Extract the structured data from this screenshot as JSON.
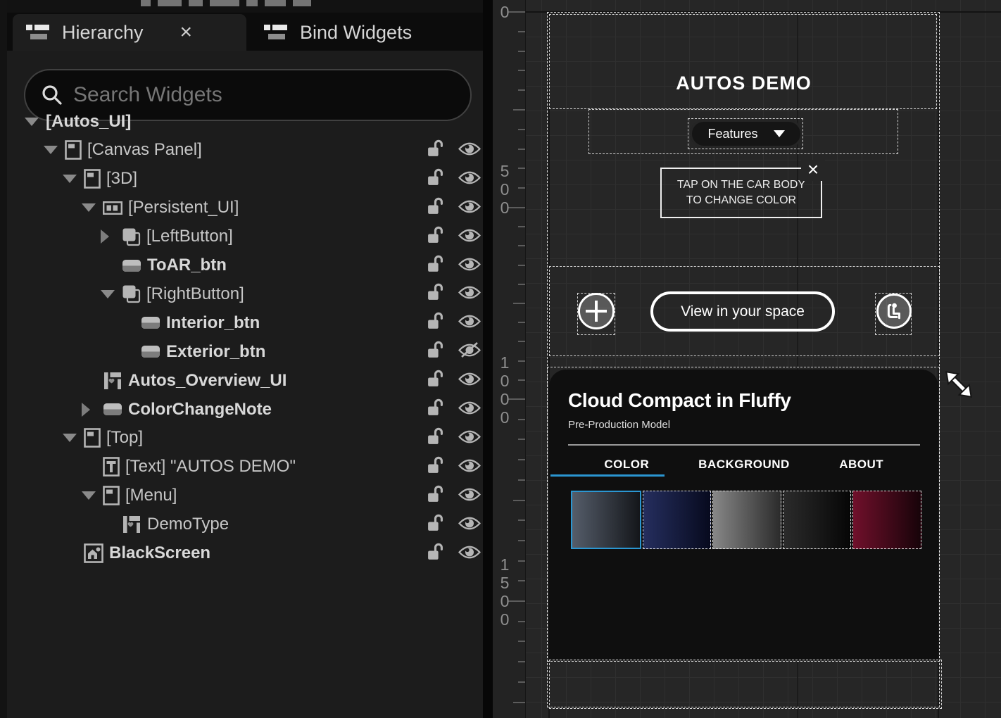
{
  "left_panel": {
    "tabs": [
      {
        "label": "Hierarchy",
        "close": "×",
        "icon": "hierarchy-list-icon"
      },
      {
        "label": "Bind Widgets",
        "icon": "bind-widgets-list-icon"
      }
    ],
    "search_placeholder": "Search Widgets",
    "tree": [
      {
        "label": "[Autos_UI]",
        "level": 0,
        "expander": "down",
        "icon": null,
        "bold": true,
        "lock": null,
        "eye": null
      },
      {
        "label": "[Canvas Panel]",
        "level": 1,
        "expander": "down",
        "icon": "canvas-panel-icon",
        "bold": false,
        "lock": "unlocked",
        "eye": "open"
      },
      {
        "label": "[3D]",
        "level": 2,
        "expander": "down",
        "icon": "canvas-panel-icon",
        "bold": false,
        "lock": "unlocked",
        "eye": "open"
      },
      {
        "label": "[Persistent_UI]",
        "level": 3,
        "expander": "down",
        "icon": "hbox-icon",
        "bold": false,
        "lock": "unlocked",
        "eye": "open"
      },
      {
        "label": "[LeftButton]",
        "level": 4,
        "expander": "right",
        "icon": "overlay-icon",
        "bold": false,
        "lock": "unlocked",
        "eye": "open"
      },
      {
        "label": "ToAR_btn",
        "level": 4,
        "expander": null,
        "icon": "button-icon",
        "bold": true,
        "lock": "unlocked",
        "eye": "open"
      },
      {
        "label": "[RightButton]",
        "level": 4,
        "expander": "down",
        "icon": "overlay-icon",
        "bold": false,
        "lock": "unlocked",
        "eye": "open"
      },
      {
        "label": "Interior_btn",
        "level": 5,
        "expander": null,
        "icon": "button-icon",
        "bold": true,
        "lock": "unlocked",
        "eye": "open"
      },
      {
        "label": "Exterior_btn",
        "level": 5,
        "expander": null,
        "icon": "button-icon",
        "bold": true,
        "lock": "unlocked",
        "eye": "crossed"
      },
      {
        "label": "Autos_Overview_UI",
        "level": 3,
        "expander": null,
        "icon": "userwidget-icon",
        "bold": true,
        "lock": "unlocked",
        "eye": "open"
      },
      {
        "label": "ColorChangeNote",
        "level": 3,
        "expander": "right",
        "icon": "button-icon",
        "bold": true,
        "lock": "unlocked",
        "eye": "open"
      },
      {
        "label": "[Top]",
        "level": 2,
        "expander": "down",
        "icon": "canvas-panel-icon",
        "bold": false,
        "lock": "unlocked",
        "eye": "open"
      },
      {
        "label": "[Text] \"AUTOS DEMO\"",
        "level": 3,
        "expander": null,
        "icon": "textblock-icon",
        "bold": false,
        "lock": "unlocked",
        "eye": "open"
      },
      {
        "label": "[Menu]",
        "level": 3,
        "expander": "down",
        "icon": "canvas-panel-icon",
        "bold": false,
        "lock": "unlocked",
        "eye": "open"
      },
      {
        "label": "DemoType",
        "level": 4,
        "expander": null,
        "icon": "userwidget-icon",
        "bold": false,
        "lock": "unlocked",
        "eye": "open"
      },
      {
        "label": "BlackScreen",
        "level": 2,
        "expander": null,
        "icon": "image-icon",
        "bold": true,
        "lock": "unlocked",
        "eye": "open"
      }
    ]
  },
  "designer": {
    "ruler_labels": [
      "0",
      "500",
      "1000",
      "1500"
    ],
    "preview": {
      "title": "AUTOS DEMO",
      "features_button": "Features",
      "note": {
        "line1": "TAP ON THE CAR BODY",
        "line2": "TO CHANGE COLOR",
        "close": "×"
      },
      "view_button": "View in your space",
      "card": {
        "title": "Cloud Compact in Fluffy",
        "subtitle": "Pre-Production Model",
        "tabs": [
          "COLOR",
          "BACKGROUND",
          "ABOUT"
        ],
        "active_tab": "COLOR",
        "swatches": [
          {
            "name": "steel-blue",
            "from": "#555d6a",
            "to": "#14161a",
            "selected": true
          },
          {
            "name": "navy",
            "from": "#252e5e",
            "to": "#070a1e",
            "selected": false
          },
          {
            "name": "silver",
            "from": "#878787",
            "to": "#2b2b2b",
            "selected": false
          },
          {
            "name": "black",
            "from": "#2b2b2b",
            "to": "#060606",
            "selected": false
          },
          {
            "name": "crimson",
            "from": "#70102b",
            "to": "#170309",
            "selected": false
          }
        ]
      },
      "accent_blue": "#2b96d1"
    }
  }
}
